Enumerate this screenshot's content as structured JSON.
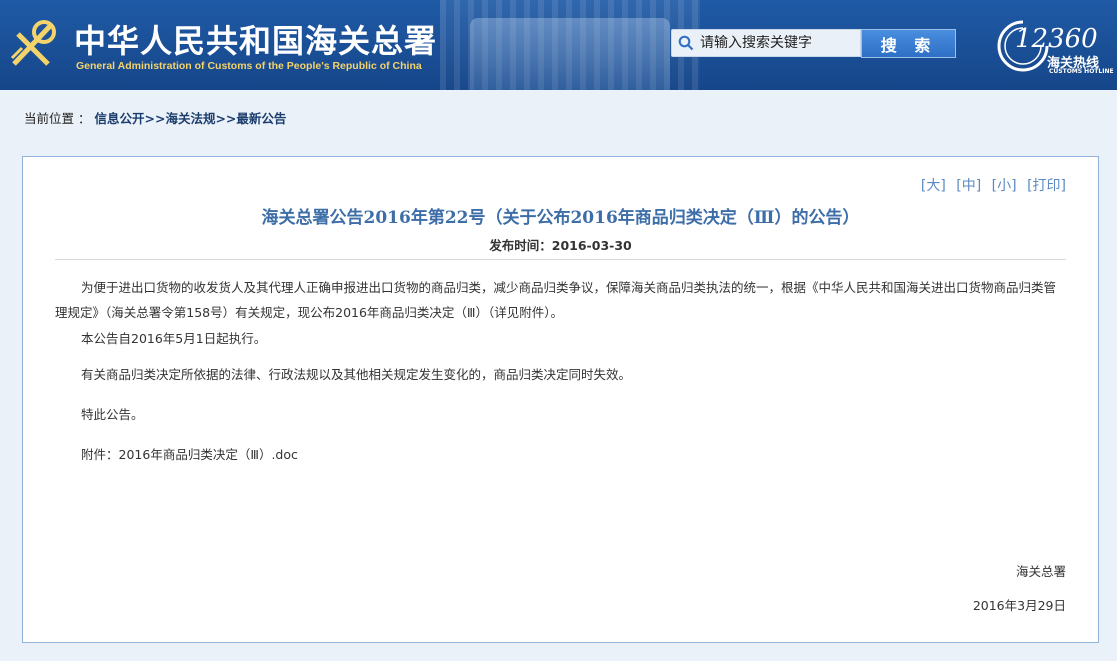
{
  "header": {
    "site_title": "中华人民共和国海关总署",
    "site_subtitle": "General Administration of Customs of the People's Republic of China",
    "search_placeholder": "请输入搜索关键字",
    "search_button": "搜 索",
    "hotline_number": "12360",
    "hotline_cn": "海关热线",
    "hotline_en": "CUSTOMS HOTLINE",
    "emblem_icon": "customs-emblem-icon",
    "accent_color": "#f4d36b",
    "banner_color": "#1f5aa6"
  },
  "breadcrumb": {
    "label": "当前位置 ：",
    "items": [
      "信息公开",
      "海关法规",
      "最新公告"
    ],
    "separator": ">>"
  },
  "article": {
    "font_links": [
      "[大]",
      "[中]",
      "[小]",
      "[打印]"
    ],
    "title": "海关总署公告2016年第22号（关于公布2016年商品归类决定（Ⅲ）的公告）",
    "publish_date": "发布时间：2016-03-30",
    "paragraphs": [
      "为便于进出口货物的收发货人及其代理人正确申报进出口货物的商品归类，减少商品归类争议，保障海关商品归类执法的统一，根据《中华人民共和国海关进出口货物商品归类管理规定》（海关总署令第158号）有关规定，现公布2016年商品归类决定（Ⅲ）（详见附件）。",
      "本公告自2016年5月1日起执行。",
      "有关商品归类决定所依据的法律、行政法规以及其他相关规定发生变化的，商品归类决定同时失效。",
      "特此公告。"
    ],
    "attachment_label": "附件：",
    "attachment_name": "2016年商品归类决定（Ⅲ）.doc",
    "signer": "海关总署",
    "sign_date": "2016年3月29日"
  }
}
